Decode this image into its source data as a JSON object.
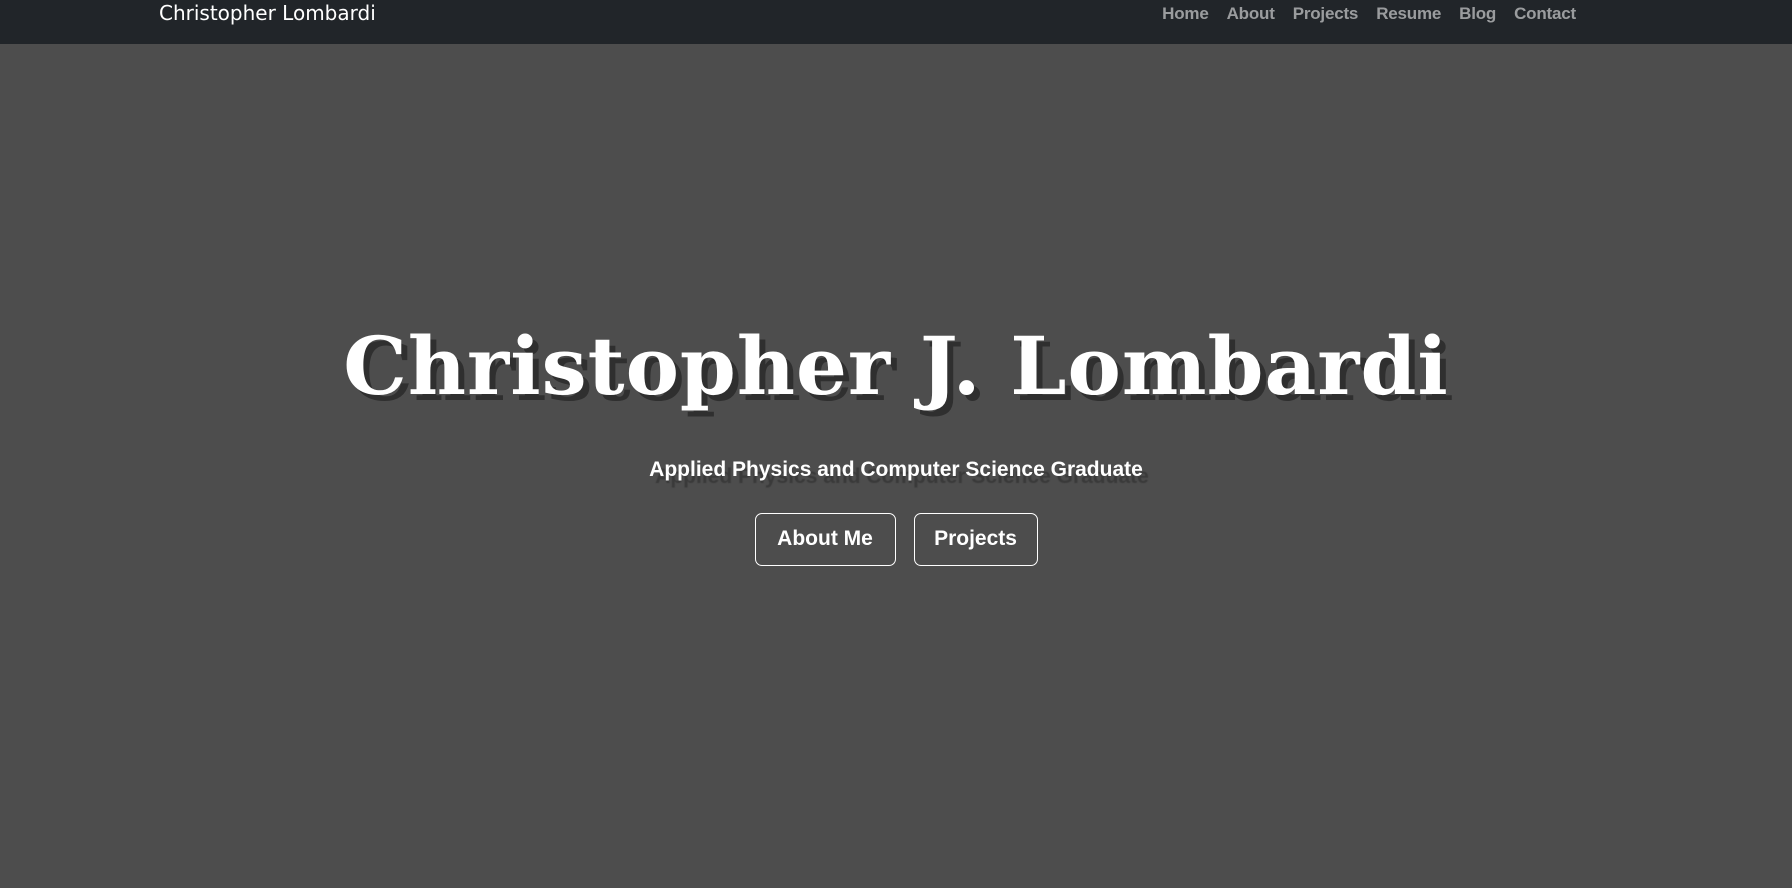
{
  "navbar": {
    "brand": "Christopher Lombardi",
    "links": [
      "Home",
      "About",
      "Projects",
      "Resume",
      "Blog",
      "Contact"
    ]
  },
  "hero": {
    "title": "Christopher J. Lombardi",
    "subtitle": "Applied Physics and Computer Science Graduate",
    "buttons": [
      "About Me",
      "Projects"
    ]
  },
  "colors": {
    "navbar_bg": "#212529",
    "page_bg": "#4d4d4d",
    "text": "#ffffff",
    "nav_link": "rgba(255,255,255,0.55)"
  }
}
